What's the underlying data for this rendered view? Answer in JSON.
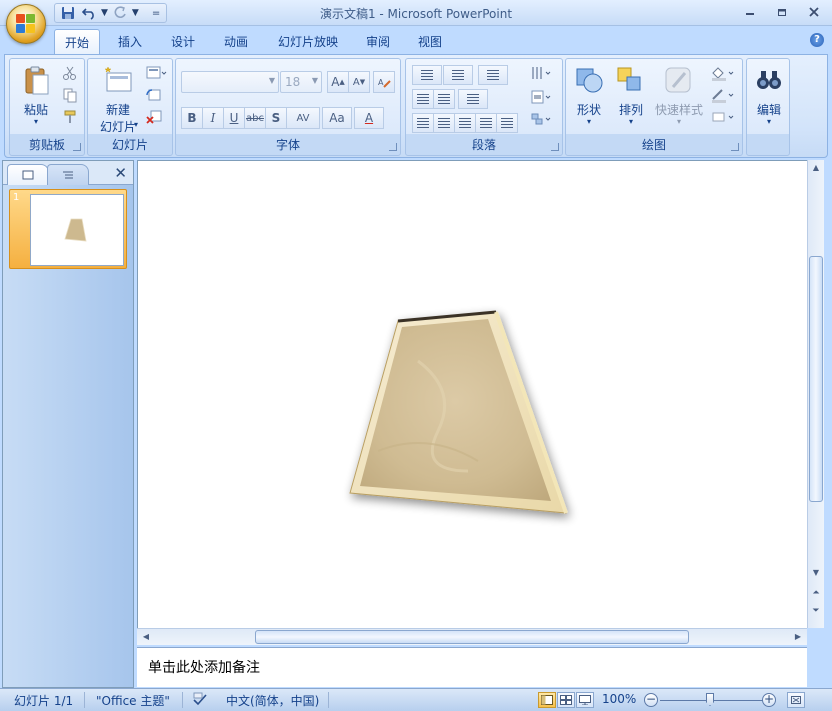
{
  "titlebar": {
    "title": "演示文稿1 - Microsoft PowerPoint",
    "qat_more": "="
  },
  "tabs": [
    "开始",
    "插入",
    "设计",
    "动画",
    "幻灯片放映",
    "审阅",
    "视图"
  ],
  "ribbon": {
    "clipboard": {
      "label": "剪贴板",
      "paste": "粘贴"
    },
    "slides": {
      "label": "幻灯片",
      "new_slide_line1": "新建",
      "new_slide_line2": "幻灯片"
    },
    "font": {
      "label": "字体",
      "font_size": "18",
      "buttons": {
        "bold": "B",
        "italic": "I",
        "underline": "U",
        "strike": "abc",
        "shadow": "S",
        "spacing": "AV",
        "case": "Aa",
        "color": "A"
      },
      "grow": "A",
      "shrink": "A"
    },
    "paragraph": {
      "label": "段落"
    },
    "drawing": {
      "label": "绘图",
      "shapes": "形状",
      "arrange": "排列",
      "quick_styles": "快速样式"
    },
    "editing": {
      "label": "编辑"
    }
  },
  "left_panel": {
    "slide_number": "1",
    "close": "✕"
  },
  "notes": {
    "placeholder": "单击此处添加备注"
  },
  "statusbar": {
    "slide_info": "幻灯片 1/1",
    "theme": "\"Office 主题\"",
    "language": "中文(简体，中国)",
    "zoom": "100%",
    "zoom_minus": "−",
    "zoom_plus": "+"
  },
  "colors": {
    "accent": "#15428b",
    "ribbon": "#dbe8fb",
    "shape_fill": "#d8c8a6"
  }
}
